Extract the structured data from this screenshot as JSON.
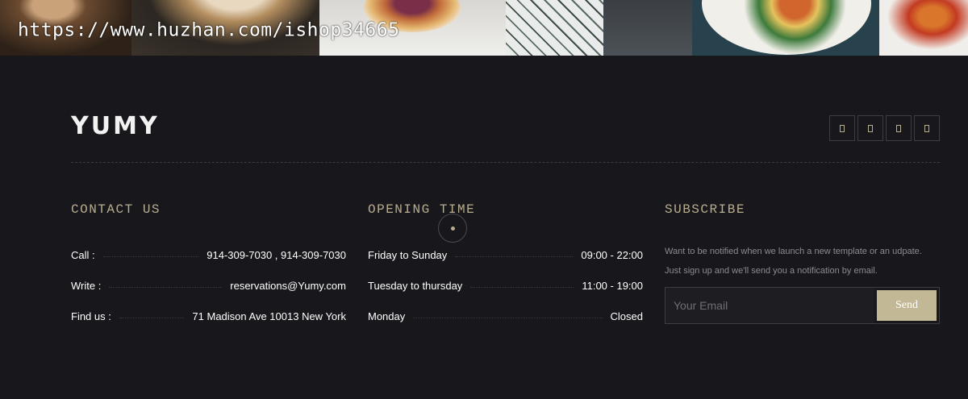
{
  "watermark": "https://www.huzhan.com/ishop34665",
  "brand": {
    "logo": "YUMY"
  },
  "social": [
    {
      "icon": "social-icon-1"
    },
    {
      "icon": "social-icon-2"
    },
    {
      "icon": "social-icon-3"
    },
    {
      "icon": "social-icon-4"
    }
  ],
  "contact": {
    "title": "CONTACT US",
    "rows": [
      {
        "label": "Call :",
        "value": "914-309-7030 , 914-309-7030"
      },
      {
        "label": "Write :",
        "value": "reservations@Yumy.com"
      },
      {
        "label": "Find us :",
        "value": "71 Madison Ave 10013 New York"
      }
    ]
  },
  "hours": {
    "title": "OPENING TIME",
    "rows": [
      {
        "label": "Friday to Sunday",
        "value": "09:00 - 22:00"
      },
      {
        "label": "Tuesday to thursday",
        "value": "11:00 - 19:00"
      },
      {
        "label": "Monday",
        "value": "Closed"
      }
    ]
  },
  "subscribe": {
    "title": "SUBSCRIBE",
    "line1": "Want to be notified when we launch a new template or an udpate.",
    "line2": "Just sign up and we'll send you a notification by email.",
    "placeholder": "Your Email",
    "button": "Send"
  },
  "colors": {
    "background": "#18181c",
    "accent": "#b8ad8f",
    "button": "#c3b896"
  }
}
